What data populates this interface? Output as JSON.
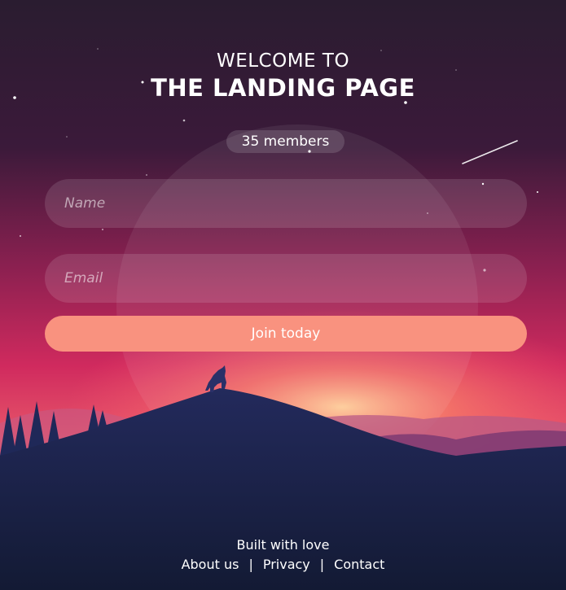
{
  "header": {
    "welcome": "WELCOME TO",
    "title": "THE LANDING PAGE",
    "members": "35 members"
  },
  "form": {
    "name_placeholder": "Name",
    "email_placeholder": "Email",
    "submit_label": "Join today"
  },
  "footer": {
    "built": "Built with love",
    "links": [
      "About us",
      "Privacy",
      "Contact"
    ],
    "separator": "|"
  },
  "colors": {
    "sky_top": "#2a1c30",
    "sky_mid": "#c8285e",
    "glow": "#ffb07a",
    "mountain": "#1d2350",
    "ground": "#151a36",
    "button": "#f9927f"
  },
  "icons": {
    "wolf": "wolf-silhouette-icon",
    "moon": "moon-icon",
    "stars": "star-icon",
    "comet": "shooting-star-icon"
  }
}
